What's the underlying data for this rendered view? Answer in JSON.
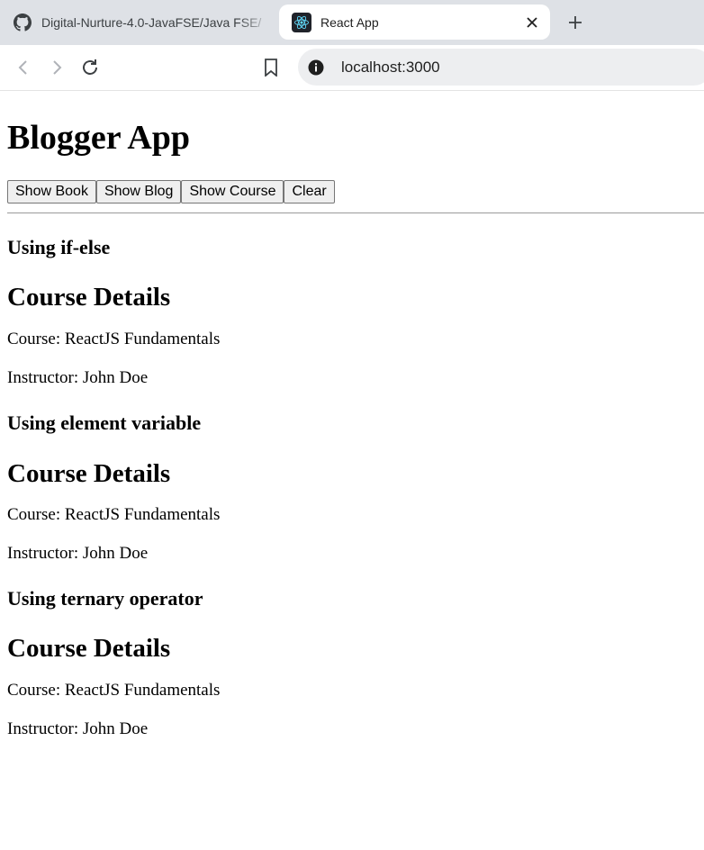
{
  "browser": {
    "tabs": [
      {
        "title": "Digital-Nurture-4.0-JavaFSE/Java FSE/",
        "favicon": "github-icon",
        "active": false
      },
      {
        "title": "React App",
        "favicon": "react-icon",
        "active": true
      }
    ],
    "url": "localhost:3000"
  },
  "app": {
    "title": "Blogger App",
    "buttons": {
      "show_book": "Show Book",
      "show_blog": "Show Blog",
      "show_course": "Show Course",
      "clear": "Clear"
    },
    "sections": [
      {
        "method": "Using if-else",
        "heading": "Course Details",
        "course": "Course: ReactJS Fundamentals",
        "instructor": "Instructor: John Doe"
      },
      {
        "method": "Using element variable",
        "heading": "Course Details",
        "course": "Course: ReactJS Fundamentals",
        "instructor": "Instructor: John Doe"
      },
      {
        "method": "Using ternary operator",
        "heading": "Course Details",
        "course": "Course: ReactJS Fundamentals",
        "instructor": "Instructor: John Doe"
      }
    ]
  },
  "colors": {
    "tabbar_bg": "#dee1e6",
    "omnibox_bg": "#edeef0",
    "react_cyan": "#61dafb"
  }
}
